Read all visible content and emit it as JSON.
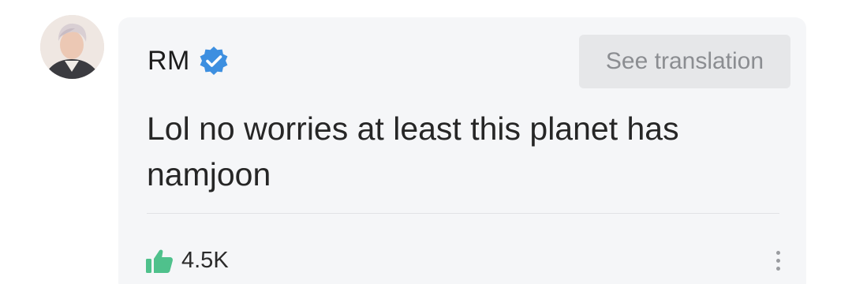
{
  "comment": {
    "author": "RM",
    "verified": true,
    "translate_label": "See translation",
    "text": "Lol no worries at least this planet has namjoon",
    "likes": "4.5K"
  },
  "icons": {
    "verified": "verified-badge-icon",
    "like": "thumbs-up-icon",
    "more": "more-vertical-icon"
  },
  "colors": {
    "verified_badge": "#3d8fe0",
    "like_icon": "#4fc18c",
    "card_background": "#f5f6f8",
    "translate_background": "#e6e7e9"
  }
}
